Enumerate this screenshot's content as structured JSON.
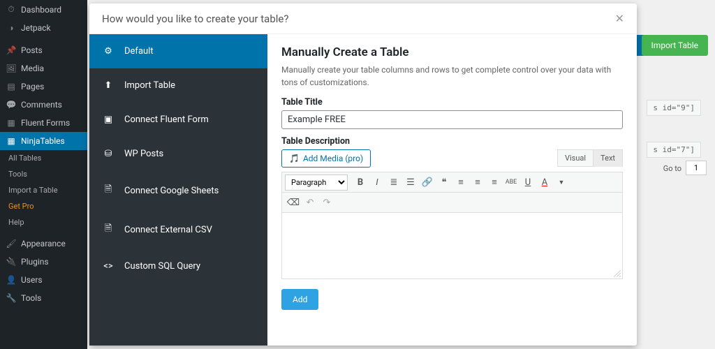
{
  "wp_sidebar": {
    "items": [
      {
        "label": "Dashboard",
        "icon": "speedometer"
      },
      {
        "label": "Jetpack",
        "icon": "circle"
      },
      {
        "label": "Posts",
        "icon": "pin"
      },
      {
        "label": "Media",
        "icon": "camera"
      },
      {
        "label": "Pages",
        "icon": "page"
      },
      {
        "label": "Comments",
        "icon": "comment"
      },
      {
        "label": "Fluent Forms",
        "icon": "form"
      },
      {
        "label": "NinjaTables",
        "icon": "table",
        "active": true
      }
    ],
    "sub_items": [
      {
        "label": "All Tables"
      },
      {
        "label": "Tools"
      },
      {
        "label": "Import a Table"
      },
      {
        "label": "Get Pro",
        "highlight": true
      },
      {
        "label": "Help"
      }
    ],
    "bottom_items": [
      {
        "label": "Appearance",
        "icon": "brush"
      },
      {
        "label": "Plugins",
        "icon": "plug"
      },
      {
        "label": "Users",
        "icon": "user"
      },
      {
        "label": "Tools",
        "icon": "wrench"
      }
    ]
  },
  "background": {
    "import_btn": "Import Table",
    "code1": "s id=\"9\"]",
    "code2": "s id=\"7\"]",
    "goto_label": "Go to",
    "goto_value": "1"
  },
  "modal": {
    "title": "How would you like to create your table?",
    "nav": [
      {
        "label": "Default",
        "icon": "gear",
        "active": true
      },
      {
        "label": "Import Table",
        "icon": "upload"
      },
      {
        "label": "Connect Fluent Form",
        "icon": "form"
      },
      {
        "label": "WP Posts",
        "icon": "db"
      },
      {
        "label": "Connect Google Sheets",
        "icon": "sheet"
      },
      {
        "label": "Connect External CSV",
        "icon": "sheet"
      },
      {
        "label": "Custom SQL Query",
        "icon": "code"
      }
    ],
    "content": {
      "heading": "Manually Create a Table",
      "description": "Manually create your table columns and rows to get complete control over your data with tons of customizations.",
      "title_label": "Table Title",
      "title_value": "Example FREE",
      "desc_label": "Table Description",
      "add_media": "Add Media (pro)",
      "tab_visual": "Visual",
      "tab_text": "Text",
      "paragraph_select": "Paragraph",
      "add_button": "Add"
    }
  }
}
